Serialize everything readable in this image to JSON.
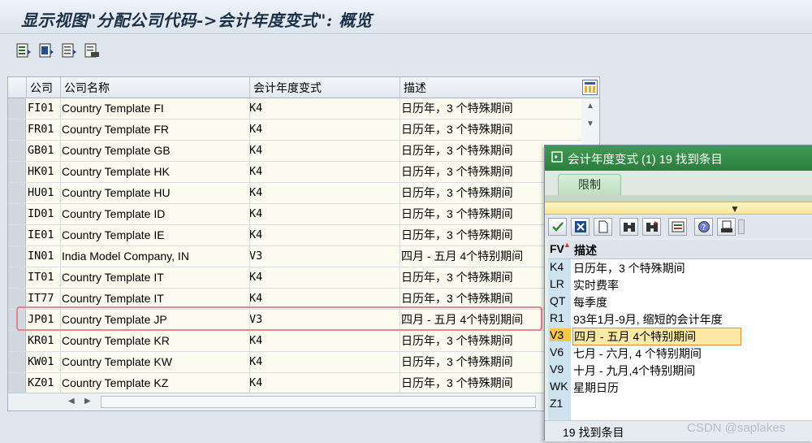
{
  "window": {
    "title": "显示视图\"分配公司代码->会计年度变式\": 概览"
  },
  "toolbar": {
    "icons": [
      "table-details-icon",
      "select-all-icon",
      "deselect-all-icon",
      "print-list-icon"
    ]
  },
  "table": {
    "columns": [
      "公司",
      "公司名称",
      "会计年度变式",
      "描述"
    ],
    "rows": [
      {
        "code": "FI01",
        "name": "Country Template FI",
        "fv": "K4",
        "desc": "日历年，3 个特殊期间"
      },
      {
        "code": "FR01",
        "name": "Country Template FR",
        "fv": "K4",
        "desc": "日历年，3 个特殊期间"
      },
      {
        "code": "GB01",
        "name": "Country Template GB",
        "fv": "K4",
        "desc": "日历年，3 个特殊期间"
      },
      {
        "code": "HK01",
        "name": "Country Template HK",
        "fv": "K4",
        "desc": "日历年，3 个特殊期间"
      },
      {
        "code": "HU01",
        "name": "Country Template HU",
        "fv": "K4",
        "desc": "日历年，3 个特殊期间"
      },
      {
        "code": "ID01",
        "name": "Country Template ID",
        "fv": "K4",
        "desc": "日历年，3 个特殊期间"
      },
      {
        "code": "IE01",
        "name": "Country Template IE",
        "fv": "K4",
        "desc": "日历年，3 个特殊期间"
      },
      {
        "code": "IN01",
        "name": "India Model Company, IN",
        "fv": "V3",
        "desc": "四月 - 五月 4个特别期间"
      },
      {
        "code": "IT01",
        "name": "Country Template IT",
        "fv": "K4",
        "desc": "日历年，3 个特殊期间"
      },
      {
        "code": "IT77",
        "name": "Country Template IT",
        "fv": "K4",
        "desc": "日历年，3 个特殊期间"
      },
      {
        "code": "JP01",
        "name": "Country Template JP",
        "fv": "V3",
        "desc": "四月 - 五月 4个特别期间"
      },
      {
        "code": "KR01",
        "name": "Country Template KR",
        "fv": "K4",
        "desc": "日历年，3 个特殊期间"
      },
      {
        "code": "KW01",
        "name": "Country Template KW",
        "fv": "K4",
        "desc": "日历年，3 个特殊期间"
      },
      {
        "code": "KZ01",
        "name": "Country Template KZ",
        "fv": "K4",
        "desc": "日历年，3 个特殊期间"
      }
    ],
    "highlight_color": "#e4868d"
  },
  "popup": {
    "title": "会计年度变式 (1)   19 找到条目",
    "tab": "限制",
    "header_key": "FV",
    "header_desc": "描述",
    "items": [
      {
        "k": "K4",
        "d": "日历年，3 个特殊期间"
      },
      {
        "k": "LR",
        "d": "实时费率"
      },
      {
        "k": "QT",
        "d": "每季度"
      },
      {
        "k": "R1",
        "d": "93年1月-9月, 缩短的会计年度"
      },
      {
        "k": "V3",
        "d": "四月 - 五月 4个特别期间",
        "selected": true
      },
      {
        "k": "V6",
        "d": "七月 - 六月, 4 个特别期间"
      },
      {
        "k": "V9",
        "d": "十月 - 九月,4个特别期间"
      },
      {
        "k": "WK",
        "d": "星期日历"
      },
      {
        "k": "Z1",
        "d": ""
      }
    ],
    "status": "19 找到条目",
    "tools": [
      "confirm-icon",
      "cancel-icon",
      "new-document-icon",
      "binoculars-icon",
      "binoculars-next-icon",
      "export-icon",
      "help-icon",
      "print-icon"
    ],
    "title_color": "#2c7d3e"
  },
  "watermark": "CSDN @saplakes"
}
